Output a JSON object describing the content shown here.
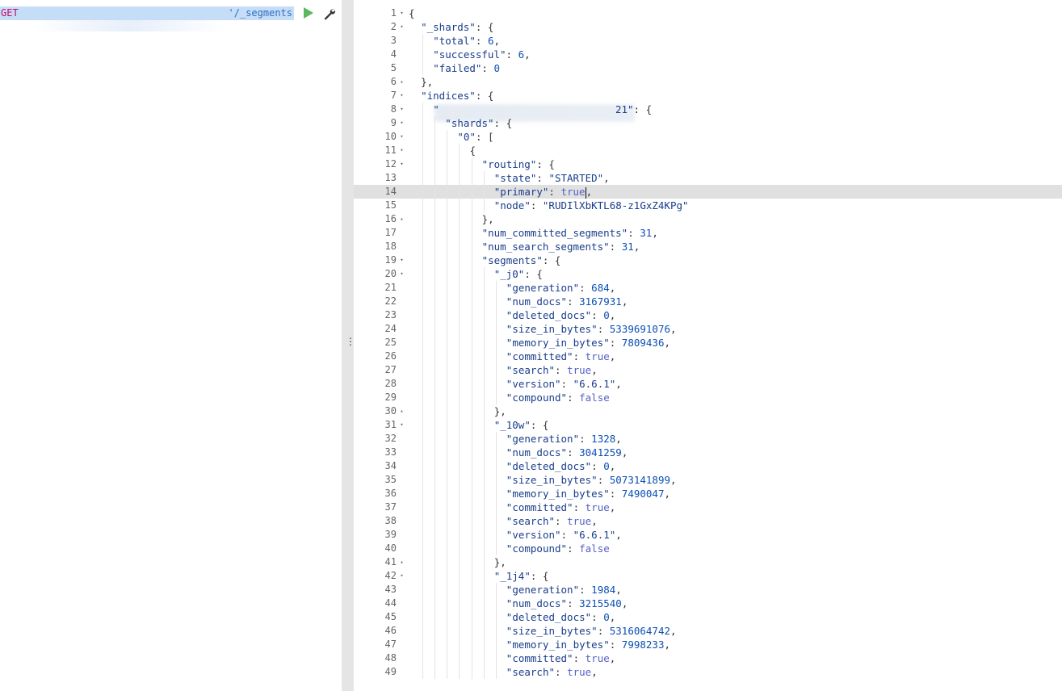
{
  "request": {
    "method": "GET",
    "url_suffix": "'/_segments",
    "run_icon": "play-icon",
    "settings_icon": "wrench-icon"
  },
  "divider": {
    "handle_icon": "vertical-ellipsis-icon",
    "handle_glyph": "⋮"
  },
  "response": {
    "active_line": 14,
    "lines": [
      {
        "n": "1",
        "fold": "▾",
        "indent": 0,
        "parts": [
          [
            "p",
            "{"
          ]
        ]
      },
      {
        "n": "2",
        "fold": "▾",
        "indent": 1,
        "parts": [
          [
            "k",
            "\"_shards\""
          ],
          [
            "p",
            ": {"
          ]
        ]
      },
      {
        "n": "3",
        "fold": "",
        "indent": 2,
        "parts": [
          [
            "k",
            "\"total\""
          ],
          [
            "p",
            ": "
          ],
          [
            "n",
            "6"
          ],
          [
            "p",
            ","
          ]
        ]
      },
      {
        "n": "4",
        "fold": "",
        "indent": 2,
        "parts": [
          [
            "k",
            "\"successful\""
          ],
          [
            "p",
            ": "
          ],
          [
            "n",
            "6"
          ],
          [
            "p",
            ","
          ]
        ]
      },
      {
        "n": "5",
        "fold": "",
        "indent": 2,
        "parts": [
          [
            "k",
            "\"failed\""
          ],
          [
            "p",
            ": "
          ],
          [
            "n",
            "0"
          ]
        ]
      },
      {
        "n": "6",
        "fold": "▴",
        "indent": 1,
        "parts": [
          [
            "p",
            "},"
          ]
        ]
      },
      {
        "n": "7",
        "fold": "▾",
        "indent": 1,
        "parts": [
          [
            "k",
            "\"indices\""
          ],
          [
            "p",
            ": {"
          ]
        ]
      },
      {
        "n": "8",
        "fold": "▾",
        "indent": 2,
        "parts": [
          [
            "k",
            "\"                             21\""
          ],
          [
            "p",
            ": {"
          ]
        ]
      },
      {
        "n": "9",
        "fold": "▾",
        "indent": 3,
        "parts": [
          [
            "k",
            "\"shards\""
          ],
          [
            "p",
            ": {"
          ]
        ]
      },
      {
        "n": "10",
        "fold": "▾",
        "indent": 4,
        "parts": [
          [
            "k",
            "\"0\""
          ],
          [
            "p",
            ": ["
          ]
        ]
      },
      {
        "n": "11",
        "fold": "▾",
        "indent": 5,
        "parts": [
          [
            "p",
            "{"
          ]
        ]
      },
      {
        "n": "12",
        "fold": "▾",
        "indent": 6,
        "parts": [
          [
            "k",
            "\"routing\""
          ],
          [
            "p",
            ": {"
          ]
        ]
      },
      {
        "n": "13",
        "fold": "",
        "indent": 7,
        "parts": [
          [
            "k",
            "\"state\""
          ],
          [
            "p",
            ": "
          ],
          [
            "s",
            "\"STARTED\""
          ],
          [
            "p",
            ","
          ]
        ]
      },
      {
        "n": "14",
        "fold": "",
        "indent": 7,
        "parts": [
          [
            "k",
            "\"primary\""
          ],
          [
            "p",
            ": "
          ],
          [
            "b",
            "true"
          ],
          [
            "cursor",
            ""
          ],
          [
            "p",
            ","
          ]
        ]
      },
      {
        "n": "15",
        "fold": "",
        "indent": 7,
        "parts": [
          [
            "k",
            "\"node\""
          ],
          [
            "p",
            ": "
          ],
          [
            "s",
            "\"RUDIlXbKTL68-z1GxZ4KPg\""
          ]
        ]
      },
      {
        "n": "16",
        "fold": "▴",
        "indent": 6,
        "parts": [
          [
            "p",
            "},"
          ]
        ]
      },
      {
        "n": "17",
        "fold": "",
        "indent": 6,
        "parts": [
          [
            "k",
            "\"num_committed_segments\""
          ],
          [
            "p",
            ": "
          ],
          [
            "n",
            "31"
          ],
          [
            "p",
            ","
          ]
        ]
      },
      {
        "n": "18",
        "fold": "",
        "indent": 6,
        "parts": [
          [
            "k",
            "\"num_search_segments\""
          ],
          [
            "p",
            ": "
          ],
          [
            "n",
            "31"
          ],
          [
            "p",
            ","
          ]
        ]
      },
      {
        "n": "19",
        "fold": "▾",
        "indent": 6,
        "parts": [
          [
            "k",
            "\"segments\""
          ],
          [
            "p",
            ": {"
          ]
        ]
      },
      {
        "n": "20",
        "fold": "▾",
        "indent": 7,
        "parts": [
          [
            "k",
            "\"_j0\""
          ],
          [
            "p",
            ": {"
          ]
        ]
      },
      {
        "n": "21",
        "fold": "",
        "indent": 8,
        "parts": [
          [
            "k",
            "\"generation\""
          ],
          [
            "p",
            ": "
          ],
          [
            "n",
            "684"
          ],
          [
            "p",
            ","
          ]
        ]
      },
      {
        "n": "22",
        "fold": "",
        "indent": 8,
        "parts": [
          [
            "k",
            "\"num_docs\""
          ],
          [
            "p",
            ": "
          ],
          [
            "n",
            "3167931"
          ],
          [
            "p",
            ","
          ]
        ]
      },
      {
        "n": "23",
        "fold": "",
        "indent": 8,
        "parts": [
          [
            "k",
            "\"deleted_docs\""
          ],
          [
            "p",
            ": "
          ],
          [
            "n",
            "0"
          ],
          [
            "p",
            ","
          ]
        ]
      },
      {
        "n": "24",
        "fold": "",
        "indent": 8,
        "parts": [
          [
            "k",
            "\"size_in_bytes\""
          ],
          [
            "p",
            ": "
          ],
          [
            "n",
            "5339691076"
          ],
          [
            "p",
            ","
          ]
        ]
      },
      {
        "n": "25",
        "fold": "",
        "indent": 8,
        "parts": [
          [
            "k",
            "\"memory_in_bytes\""
          ],
          [
            "p",
            ": "
          ],
          [
            "n",
            "7809436"
          ],
          [
            "p",
            ","
          ]
        ]
      },
      {
        "n": "26",
        "fold": "",
        "indent": 8,
        "parts": [
          [
            "k",
            "\"committed\""
          ],
          [
            "p",
            ": "
          ],
          [
            "b",
            "true"
          ],
          [
            "p",
            ","
          ]
        ]
      },
      {
        "n": "27",
        "fold": "",
        "indent": 8,
        "parts": [
          [
            "k",
            "\"search\""
          ],
          [
            "p",
            ": "
          ],
          [
            "b",
            "true"
          ],
          [
            "p",
            ","
          ]
        ]
      },
      {
        "n": "28",
        "fold": "",
        "indent": 8,
        "parts": [
          [
            "k",
            "\"version\""
          ],
          [
            "p",
            ": "
          ],
          [
            "s",
            "\"6.6.1\""
          ],
          [
            "p",
            ","
          ]
        ]
      },
      {
        "n": "29",
        "fold": "",
        "indent": 8,
        "parts": [
          [
            "k",
            "\"compound\""
          ],
          [
            "p",
            ": "
          ],
          [
            "b",
            "false"
          ]
        ]
      },
      {
        "n": "30",
        "fold": "▴",
        "indent": 7,
        "parts": [
          [
            "p",
            "},"
          ]
        ]
      },
      {
        "n": "31",
        "fold": "▾",
        "indent": 7,
        "parts": [
          [
            "k",
            "\"_10w\""
          ],
          [
            "p",
            ": {"
          ]
        ]
      },
      {
        "n": "32",
        "fold": "",
        "indent": 8,
        "parts": [
          [
            "k",
            "\"generation\""
          ],
          [
            "p",
            ": "
          ],
          [
            "n",
            "1328"
          ],
          [
            "p",
            ","
          ]
        ]
      },
      {
        "n": "33",
        "fold": "",
        "indent": 8,
        "parts": [
          [
            "k",
            "\"num_docs\""
          ],
          [
            "p",
            ": "
          ],
          [
            "n",
            "3041259"
          ],
          [
            "p",
            ","
          ]
        ]
      },
      {
        "n": "34",
        "fold": "",
        "indent": 8,
        "parts": [
          [
            "k",
            "\"deleted_docs\""
          ],
          [
            "p",
            ": "
          ],
          [
            "n",
            "0"
          ],
          [
            "p",
            ","
          ]
        ]
      },
      {
        "n": "35",
        "fold": "",
        "indent": 8,
        "parts": [
          [
            "k",
            "\"size_in_bytes\""
          ],
          [
            "p",
            ": "
          ],
          [
            "n",
            "5073141899"
          ],
          [
            "p",
            ","
          ]
        ]
      },
      {
        "n": "36",
        "fold": "",
        "indent": 8,
        "parts": [
          [
            "k",
            "\"memory_in_bytes\""
          ],
          [
            "p",
            ": "
          ],
          [
            "n",
            "7490047"
          ],
          [
            "p",
            ","
          ]
        ]
      },
      {
        "n": "37",
        "fold": "",
        "indent": 8,
        "parts": [
          [
            "k",
            "\"committed\""
          ],
          [
            "p",
            ": "
          ],
          [
            "b",
            "true"
          ],
          [
            "p",
            ","
          ]
        ]
      },
      {
        "n": "38",
        "fold": "",
        "indent": 8,
        "parts": [
          [
            "k",
            "\"search\""
          ],
          [
            "p",
            ": "
          ],
          [
            "b",
            "true"
          ],
          [
            "p",
            ","
          ]
        ]
      },
      {
        "n": "39",
        "fold": "",
        "indent": 8,
        "parts": [
          [
            "k",
            "\"version\""
          ],
          [
            "p",
            ": "
          ],
          [
            "s",
            "\"6.6.1\""
          ],
          [
            "p",
            ","
          ]
        ]
      },
      {
        "n": "40",
        "fold": "",
        "indent": 8,
        "parts": [
          [
            "k",
            "\"compound\""
          ],
          [
            "p",
            ": "
          ],
          [
            "b",
            "false"
          ]
        ]
      },
      {
        "n": "41",
        "fold": "▴",
        "indent": 7,
        "parts": [
          [
            "p",
            "},"
          ]
        ]
      },
      {
        "n": "42",
        "fold": "▾",
        "indent": 7,
        "parts": [
          [
            "k",
            "\"_1j4\""
          ],
          [
            "p",
            ": {"
          ]
        ]
      },
      {
        "n": "43",
        "fold": "",
        "indent": 8,
        "parts": [
          [
            "k",
            "\"generation\""
          ],
          [
            "p",
            ": "
          ],
          [
            "n",
            "1984"
          ],
          [
            "p",
            ","
          ]
        ]
      },
      {
        "n": "44",
        "fold": "",
        "indent": 8,
        "parts": [
          [
            "k",
            "\"num_docs\""
          ],
          [
            "p",
            ": "
          ],
          [
            "n",
            "3215540"
          ],
          [
            "p",
            ","
          ]
        ]
      },
      {
        "n": "45",
        "fold": "",
        "indent": 8,
        "parts": [
          [
            "k",
            "\"deleted_docs\""
          ],
          [
            "p",
            ": "
          ],
          [
            "n",
            "0"
          ],
          [
            "p",
            ","
          ]
        ]
      },
      {
        "n": "46",
        "fold": "",
        "indent": 8,
        "parts": [
          [
            "k",
            "\"size_in_bytes\""
          ],
          [
            "p",
            ": "
          ],
          [
            "n",
            "5316064742"
          ],
          [
            "p",
            ","
          ]
        ]
      },
      {
        "n": "47",
        "fold": "",
        "indent": 8,
        "parts": [
          [
            "k",
            "\"memory_in_bytes\""
          ],
          [
            "p",
            ": "
          ],
          [
            "n",
            "7998233"
          ],
          [
            "p",
            ","
          ]
        ]
      },
      {
        "n": "48",
        "fold": "",
        "indent": 8,
        "parts": [
          [
            "k",
            "\"committed\""
          ],
          [
            "p",
            ": "
          ],
          [
            "b",
            "true"
          ],
          [
            "p",
            ","
          ]
        ]
      },
      {
        "n": "49",
        "fold": "",
        "indent": 8,
        "parts": [
          [
            "k",
            "\"search\""
          ],
          [
            "p",
            ": "
          ],
          [
            "b",
            "true"
          ],
          [
            "p",
            ","
          ]
        ]
      }
    ]
  }
}
